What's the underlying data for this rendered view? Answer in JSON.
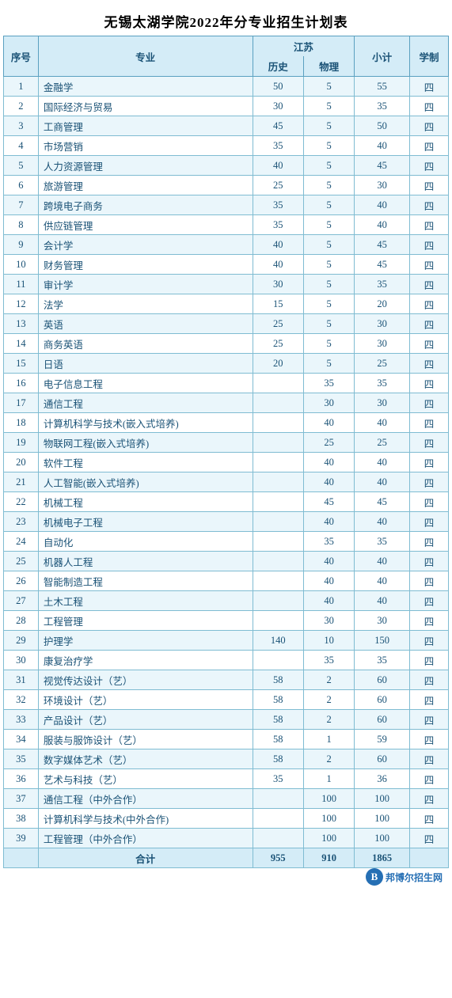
{
  "title": "无锡太湖学院2022年分专业招生计划表",
  "header": {
    "col_seq": "序号",
    "col_major": "专业",
    "col_jiangsu": "江苏",
    "col_history": "历史",
    "col_physics": "物理",
    "col_subtotal": "小计",
    "col_years": "学制"
  },
  "rows": [
    {
      "seq": "1",
      "major": "金融学",
      "history": "50",
      "physics": "5",
      "subtotal": "55",
      "years": "四"
    },
    {
      "seq": "2",
      "major": "国际经济与贸易",
      "history": "30",
      "physics": "5",
      "subtotal": "35",
      "years": "四"
    },
    {
      "seq": "3",
      "major": "工商管理",
      "history": "45",
      "physics": "5",
      "subtotal": "50",
      "years": "四"
    },
    {
      "seq": "4",
      "major": "市场营销",
      "history": "35",
      "physics": "5",
      "subtotal": "40",
      "years": "四"
    },
    {
      "seq": "5",
      "major": "人力资源管理",
      "history": "40",
      "physics": "5",
      "subtotal": "45",
      "years": "四"
    },
    {
      "seq": "6",
      "major": "旅游管理",
      "history": "25",
      "physics": "5",
      "subtotal": "30",
      "years": "四"
    },
    {
      "seq": "7",
      "major": "跨境电子商务",
      "history": "35",
      "physics": "5",
      "subtotal": "40",
      "years": "四"
    },
    {
      "seq": "8",
      "major": "供应链管理",
      "history": "35",
      "physics": "5",
      "subtotal": "40",
      "years": "四"
    },
    {
      "seq": "9",
      "major": "会计学",
      "history": "40",
      "physics": "5",
      "subtotal": "45",
      "years": "四"
    },
    {
      "seq": "10",
      "major": "财务管理",
      "history": "40",
      "physics": "5",
      "subtotal": "45",
      "years": "四"
    },
    {
      "seq": "11",
      "major": "审计学",
      "history": "30",
      "physics": "5",
      "subtotal": "35",
      "years": "四"
    },
    {
      "seq": "12",
      "major": "法学",
      "history": "15",
      "physics": "5",
      "subtotal": "20",
      "years": "四"
    },
    {
      "seq": "13",
      "major": "英语",
      "history": "25",
      "physics": "5",
      "subtotal": "30",
      "years": "四"
    },
    {
      "seq": "14",
      "major": "商务英语",
      "history": "25",
      "physics": "5",
      "subtotal": "30",
      "years": "四"
    },
    {
      "seq": "15",
      "major": "日语",
      "history": "20",
      "physics": "5",
      "subtotal": "25",
      "years": "四"
    },
    {
      "seq": "16",
      "major": "电子信息工程",
      "history": "",
      "physics": "35",
      "subtotal": "35",
      "years": "四"
    },
    {
      "seq": "17",
      "major": "通信工程",
      "history": "",
      "physics": "30",
      "subtotal": "30",
      "years": "四"
    },
    {
      "seq": "18",
      "major": "计算机科学与技术(嵌入式培养)",
      "history": "",
      "physics": "40",
      "subtotal": "40",
      "years": "四"
    },
    {
      "seq": "19",
      "major": "物联网工程(嵌入式培养)",
      "history": "",
      "physics": "25",
      "subtotal": "25",
      "years": "四"
    },
    {
      "seq": "20",
      "major": "软件工程",
      "history": "",
      "physics": "40",
      "subtotal": "40",
      "years": "四"
    },
    {
      "seq": "21",
      "major": "人工智能(嵌入式培养)",
      "history": "",
      "physics": "40",
      "subtotal": "40",
      "years": "四"
    },
    {
      "seq": "22",
      "major": "机械工程",
      "history": "",
      "physics": "45",
      "subtotal": "45",
      "years": "四"
    },
    {
      "seq": "23",
      "major": "机械电子工程",
      "history": "",
      "physics": "40",
      "subtotal": "40",
      "years": "四"
    },
    {
      "seq": "24",
      "major": "自动化",
      "history": "",
      "physics": "35",
      "subtotal": "35",
      "years": "四"
    },
    {
      "seq": "25",
      "major": "机器人工程",
      "history": "",
      "physics": "40",
      "subtotal": "40",
      "years": "四"
    },
    {
      "seq": "26",
      "major": "智能制造工程",
      "history": "",
      "physics": "40",
      "subtotal": "40",
      "years": "四"
    },
    {
      "seq": "27",
      "major": "土木工程",
      "history": "",
      "physics": "40",
      "subtotal": "40",
      "years": "四"
    },
    {
      "seq": "28",
      "major": "工程管理",
      "history": "",
      "physics": "30",
      "subtotal": "30",
      "years": "四"
    },
    {
      "seq": "29",
      "major": "护理学",
      "history": "140",
      "physics": "10",
      "subtotal": "150",
      "years": "四"
    },
    {
      "seq": "30",
      "major": "康复治疗学",
      "history": "",
      "physics": "35",
      "subtotal": "35",
      "years": "四"
    },
    {
      "seq": "31",
      "major": "视觉传达设计（艺）",
      "history": "58",
      "physics": "2",
      "subtotal": "60",
      "years": "四"
    },
    {
      "seq": "32",
      "major": "环境设计（艺）",
      "history": "58",
      "physics": "2",
      "subtotal": "60",
      "years": "四"
    },
    {
      "seq": "33",
      "major": "产品设计（艺）",
      "history": "58",
      "physics": "2",
      "subtotal": "60",
      "years": "四"
    },
    {
      "seq": "34",
      "major": "服装与服饰设计（艺）",
      "history": "58",
      "physics": "1",
      "subtotal": "59",
      "years": "四"
    },
    {
      "seq": "35",
      "major": "数字媒体艺术（艺）",
      "history": "58",
      "physics": "2",
      "subtotal": "60",
      "years": "四"
    },
    {
      "seq": "36",
      "major": "艺术与科技（艺）",
      "history": "35",
      "physics": "1",
      "subtotal": "36",
      "years": "四"
    },
    {
      "seq": "37",
      "major": "通信工程（中外合作）",
      "history": "",
      "physics": "100",
      "subtotal": "100",
      "years": "四"
    },
    {
      "seq": "38",
      "major": "计算机科学与技术(中外合作)",
      "history": "",
      "physics": "100",
      "subtotal": "100",
      "years": "四"
    },
    {
      "seq": "39",
      "major": "工程管理（中外合作）",
      "history": "",
      "physics": "100",
      "subtotal": "100",
      "years": "四"
    }
  ],
  "total_row": {
    "label": "合计",
    "history": "955",
    "physics": "910",
    "subtotal": "1865",
    "years": ""
  },
  "watermark": {
    "logo_letter": "B",
    "text": "邦博尔招生网"
  }
}
